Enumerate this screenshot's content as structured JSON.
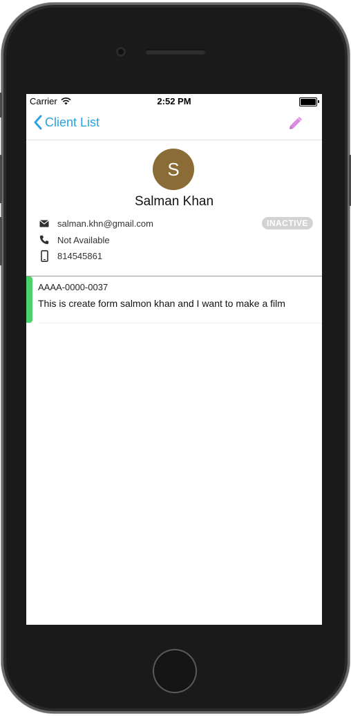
{
  "status_bar": {
    "carrier": "Carrier",
    "time": "2:52 PM"
  },
  "nav": {
    "back_label": "Client List",
    "back_icon": "chevron-left-icon",
    "edit_icon": "pencil-icon",
    "accent_color": "#2aa3e0",
    "edit_color": "#d98ce0"
  },
  "client": {
    "initial": "S",
    "name": "Salman Khan",
    "email": "salman.khn@gmail.com",
    "phone": "Not Available",
    "mobile": "814545861",
    "status": "INACTIVE",
    "avatar_color": "#8b6b36"
  },
  "notes": [
    {
      "id": "AAAA-0000-0037",
      "text": "This is create form salmon khan and I want to make a film",
      "accent_color": "#4cd26a"
    }
  ]
}
